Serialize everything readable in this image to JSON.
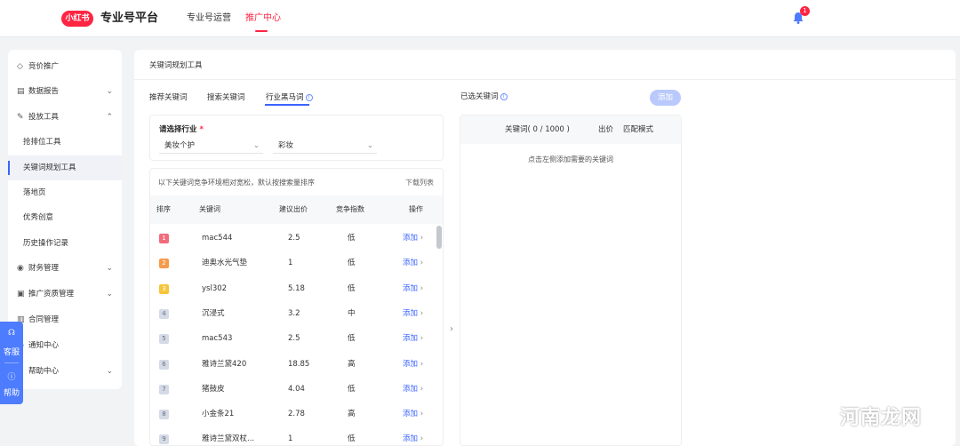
{
  "header": {
    "logo": "小红书",
    "platform_title": "专业号平台",
    "nav": [
      "专业号运营",
      "推广中心"
    ],
    "notification_count": "1"
  },
  "sidebar": {
    "items": [
      {
        "label": "竞价推广",
        "icon": "tag-icon"
      },
      {
        "label": "数据报告",
        "icon": "report-icon"
      },
      {
        "label": "投放工具",
        "icon": "tool-icon"
      },
      {
        "label": "抢排位工具"
      },
      {
        "label": "关键词规划工具"
      },
      {
        "label": "落地页"
      },
      {
        "label": "优秀创意"
      },
      {
        "label": "历史操作记录"
      },
      {
        "label": "财务管理",
        "icon": "finance-icon"
      },
      {
        "label": "推广资质管理",
        "icon": "qualification-icon"
      },
      {
        "label": "合同管理",
        "icon": "contract-icon"
      },
      {
        "label": "通知中心",
        "icon": "notice-icon"
      },
      {
        "label": "帮助中心",
        "icon": "help-icon"
      }
    ]
  },
  "float_help": {
    "service": "客服",
    "help": "帮助"
  },
  "main": {
    "title": "关键词规划工具",
    "tabs": [
      "推荐关键词",
      "搜索关键词",
      "行业黑马词"
    ],
    "industry_label": "请选择行业",
    "industry_select_1": "美妆个护",
    "industry_select_2": "彩妆",
    "kw_desc": "以下关键词竞争环境相对宽松，默认按搜索量排序",
    "kw_download": "下载列表",
    "kw_columns": [
      "排序",
      "关键词",
      "建议出价",
      "竞争指数",
      "操作"
    ],
    "kw_rows": [
      {
        "rank": "1",
        "keyword": "mac544",
        "bid": "2.5",
        "competition": "低",
        "action": "添加"
      },
      {
        "rank": "2",
        "keyword": "迪奥水光气垫",
        "bid": "1",
        "competition": "低",
        "action": "添加"
      },
      {
        "rank": "3",
        "keyword": "ysl302",
        "bid": "5.18",
        "competition": "低",
        "action": "添加"
      },
      {
        "rank": "4",
        "keyword": "沉浸式",
        "bid": "3.2",
        "competition": "中",
        "action": "添加"
      },
      {
        "rank": "5",
        "keyword": "mac543",
        "bid": "2.5",
        "competition": "低",
        "action": "添加"
      },
      {
        "rank": "6",
        "keyword": "雅诗兰黛420",
        "bid": "18.85",
        "competition": "高",
        "action": "添加"
      },
      {
        "rank": "7",
        "keyword": "猪鼓皮",
        "bid": "4.04",
        "competition": "低",
        "action": "添加"
      },
      {
        "rank": "8",
        "keyword": "小金条21",
        "bid": "2.78",
        "competition": "高",
        "action": "添加"
      },
      {
        "rank": "9",
        "keyword": "雅诗兰黛双杖...",
        "bid": "1",
        "competition": "低",
        "action": "添加"
      }
    ],
    "selected_title": "已选关键词",
    "add_button": "添加",
    "selected_columns": [
      "关键词( 0 / 1000 )",
      "出价",
      "匹配模式"
    ],
    "selected_empty": "点击左侧添加需要的关键词"
  },
  "watermark": "河南龙网",
  "colors": {
    "brand": "#ff2442",
    "accent": "#3a64ff",
    "rank1": "#f26b7a",
    "rank2": "#f79a4c",
    "rank3": "#f7c43a"
  }
}
